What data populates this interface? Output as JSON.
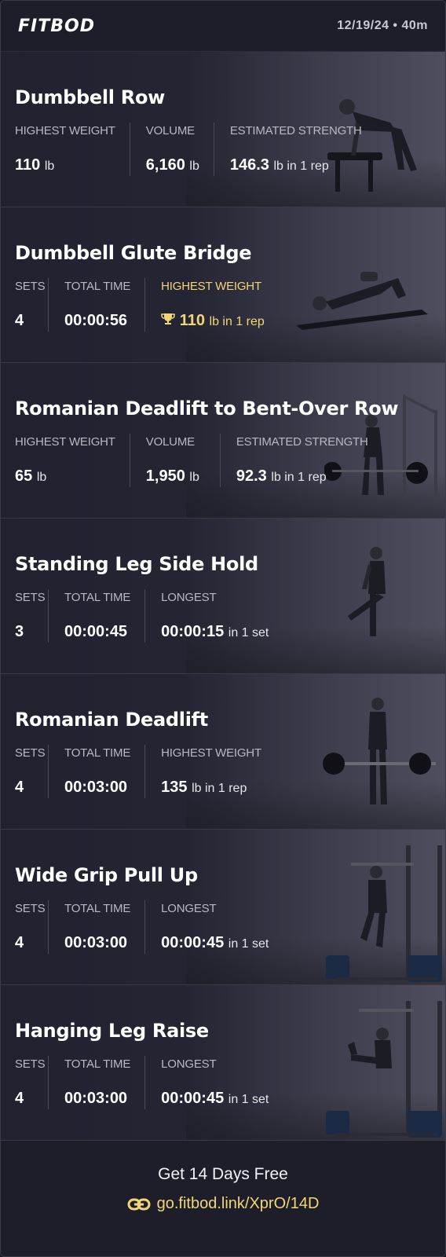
{
  "header": {
    "logo": "FITBOD",
    "date": "12/19/24 • 40m"
  },
  "accent_gold": "#f2d675",
  "exercises": [
    {
      "title": "Dumbbell Row",
      "stats": [
        {
          "label": "HIGHEST WEIGHT",
          "value": "110",
          "unit": "lb"
        },
        {
          "label": "VOLUME",
          "value": "6,160",
          "unit": "lb"
        },
        {
          "label": "ESTIMATED STRENGTH",
          "value": "146.3",
          "unit": "lb in 1 rep"
        }
      ]
    },
    {
      "title": "Dumbbell Glute Bridge",
      "stats": [
        {
          "label": "SETS",
          "value": "4",
          "unit": ""
        },
        {
          "label": "TOTAL TIME",
          "value": "00:00:56",
          "unit": ""
        },
        {
          "label": "HIGHEST WEIGHT",
          "value": "110",
          "unit": "lb in 1 rep",
          "icon": "trophy-icon",
          "highlight": true
        }
      ]
    },
    {
      "title": "Romanian Deadlift to Bent-Over Row",
      "stats": [
        {
          "label": "HIGHEST WEIGHT",
          "value": "65",
          "unit": "lb"
        },
        {
          "label": "VOLUME",
          "value": "1,950",
          "unit": "lb"
        },
        {
          "label": "ESTIMATED STRENGTH",
          "value": "92.3",
          "unit": "lb in 1 rep"
        }
      ]
    },
    {
      "title": "Standing Leg Side Hold",
      "stats": [
        {
          "label": "SETS",
          "value": "3",
          "unit": ""
        },
        {
          "label": "TOTAL TIME",
          "value": "00:00:45",
          "unit": ""
        },
        {
          "label": "LONGEST",
          "value": "00:00:15",
          "unit": "in 1 set"
        }
      ]
    },
    {
      "title": "Romanian Deadlift",
      "stats": [
        {
          "label": "SETS",
          "value": "4",
          "unit": ""
        },
        {
          "label": "TOTAL TIME",
          "value": "00:03:00",
          "unit": ""
        },
        {
          "label": "HIGHEST WEIGHT",
          "value": "135",
          "unit": "lb in 1 rep"
        }
      ]
    },
    {
      "title": "Wide Grip Pull Up",
      "stats": [
        {
          "label": "SETS",
          "value": "4",
          "unit": ""
        },
        {
          "label": "TOTAL TIME",
          "value": "00:03:00",
          "unit": ""
        },
        {
          "label": "LONGEST",
          "value": "00:00:45",
          "unit": "in 1 set"
        }
      ]
    },
    {
      "title": "Hanging Leg Raise",
      "stats": [
        {
          "label": "SETS",
          "value": "4",
          "unit": ""
        },
        {
          "label": "TOTAL TIME",
          "value": "00:03:00",
          "unit": ""
        },
        {
          "label": "LONGEST",
          "value": "00:00:45",
          "unit": "in 1 set"
        }
      ]
    }
  ],
  "footer": {
    "cta": "Get 14 Days Free",
    "link_icon": "link-icon",
    "link": "go.fitbod.link/XprO/14D"
  }
}
